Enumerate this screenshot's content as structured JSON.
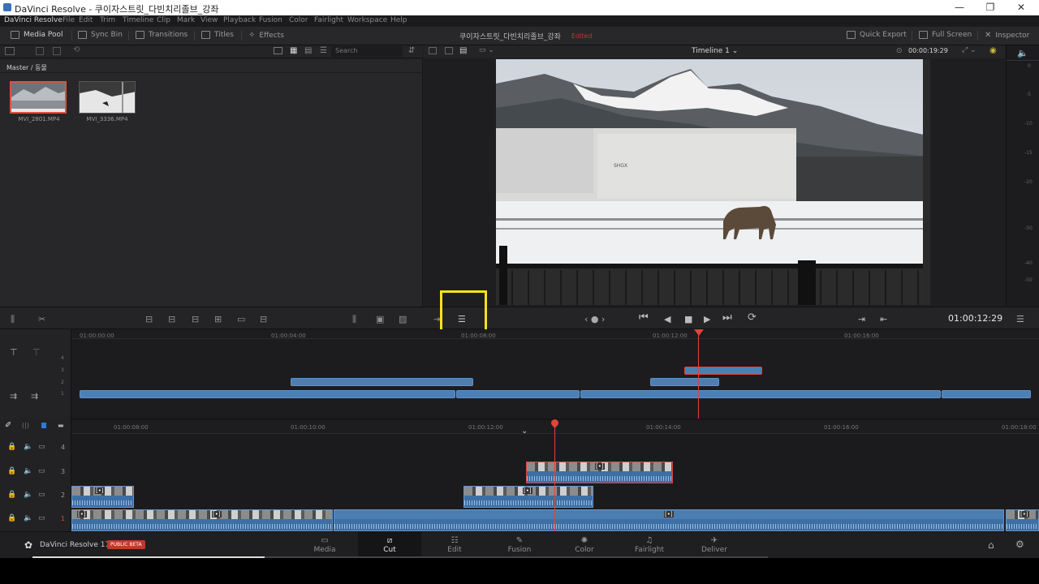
{
  "window": {
    "title": "DaVinci Resolve - 쿠이자스트릿_다빈치리졸브_강좌",
    "controls": [
      "—",
      "❐",
      "✕"
    ]
  },
  "menu": [
    "DaVinci Resolve",
    "File",
    "Edit",
    "Trim",
    "Timeline",
    "Clip",
    "Mark",
    "View",
    "Playback",
    "Fusion",
    "Color",
    "Fairlight",
    "Workspace",
    "Help"
  ],
  "toolbar": {
    "media_pool": "Media Pool",
    "sync_bin": "Sync Bin",
    "transitions": "Transitions",
    "titles": "Titles",
    "effects": "Effects",
    "project_name": "쿠이자스트릿_다빈치리졸브_강좌",
    "edited": "Edited",
    "quick_export": "Quick Export",
    "full_screen": "Full Screen",
    "inspector": "Inspector"
  },
  "media_pool": {
    "search_placeholder": "Search",
    "breadcrumb": "Master / 동물",
    "clips": [
      {
        "name": "MVI_2801.MP4"
      },
      {
        "name": "MVI_3336.MP4"
      }
    ]
  },
  "viewer": {
    "duration": "00:00:19:29",
    "timeline_name": "Timeline 1",
    "timecode": "01:00:12:29",
    "meter_labels": [
      "0",
      "-5",
      "-10",
      "-15",
      "-20",
      "-30",
      "-40",
      "-50"
    ],
    "transport": [
      "⏮",
      "◀",
      "■",
      "▶",
      "⏭",
      "⟳"
    ],
    "jog": "‹ ● ›"
  },
  "upper_timeline": {
    "ruler": [
      "01:00:00:00",
      "01:00:04:00",
      "01:00:08:00",
      "01:00:12:00",
      "01:00:16:00"
    ],
    "track_numbers": [
      "4",
      "3",
      "2",
      "1"
    ]
  },
  "lower_timeline": {
    "ruler": [
      "01:00:08:00",
      "01:00:10:00",
      "01:00:12:00",
      "01:00:14:00",
      "01:00:16:00",
      "01:00:18:00"
    ],
    "tracks": [
      "4",
      "3",
      "2",
      "1"
    ]
  },
  "pages": [
    {
      "label": "Media",
      "icon": "media-page-icon"
    },
    {
      "label": "Cut",
      "icon": "cut-page-icon"
    },
    {
      "label": "Edit",
      "icon": "edit-page-icon"
    },
    {
      "label": "Fusion",
      "icon": "fusion-page-icon"
    },
    {
      "label": "Color",
      "icon": "color-page-icon"
    },
    {
      "label": "Fairlight",
      "icon": "fairlight-page-icon"
    },
    {
      "label": "Deliver",
      "icon": "deliver-page-icon"
    }
  ],
  "app_version": "DaVinci Resolve 17",
  "badge": "PUBLIC BETA",
  "colors": {
    "accent_red": "#e0443a",
    "clip_blue": "#4b7fb5",
    "highlight": "#f7e21a"
  }
}
